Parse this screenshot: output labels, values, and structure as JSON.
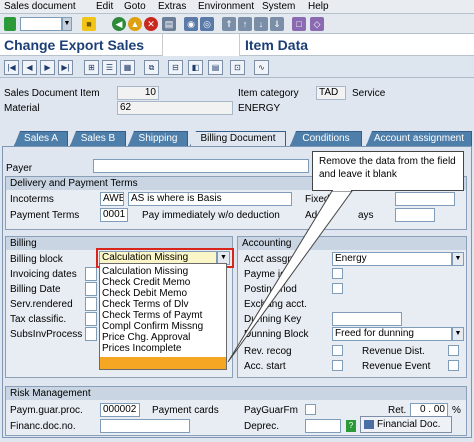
{
  "menu": [
    "Sales document",
    "Edit",
    "Goto",
    "Extras",
    "Environment",
    "System",
    "Help"
  ],
  "title": {
    "left": "Change Export Sales",
    "right": "Item Data"
  },
  "header": {
    "item_label": "Sales Document Item",
    "item_value": "10",
    "material_label": "Material",
    "material_value": "62",
    "category_label": "Item category",
    "category_value": "TAD",
    "category_text": "Service",
    "material_desc": "ENERGY"
  },
  "tabs": [
    "Sales A",
    "Sales B",
    "Shipping",
    "Billing Document",
    "Conditions",
    "Account assignment"
  ],
  "payer_label": "Payer",
  "delivery": {
    "title": "Delivery and Payment Terms",
    "incoterms_label": "Incoterms",
    "incoterms_code": "AWB",
    "incoterms_text": "AS is where is Basis",
    "payterms_label": "Payment Terms",
    "payterms_code": "0001",
    "payterms_text": "Pay immediately w/o deduction",
    "fixed_label": "Fixed",
    "add_label": "Ad",
    "days_label": "ays"
  },
  "billing": {
    "title": "Billing",
    "labels": [
      "Billing block",
      "Invoicing dates",
      "Billing Date",
      "Serv.rendered",
      "Tax classific.",
      "SubsInvProcess"
    ],
    "block_value": "Calculation Missing"
  },
  "dropdown": [
    "Calculation Missing",
    "Check Credit Memo",
    "Check Debit Memo",
    "Check Terms of Dlv",
    "Check Terms of Paymt",
    "Compl Confirm Missng",
    "Price Chg. Approval",
    "Prices Incomplete"
  ],
  "accounting": {
    "title": "Accounting",
    "acct_label": "Acct assgn",
    "acct_value": "Energy",
    "period_label": "Payme   iod",
    "posting_label": "Postin   eriod",
    "exch_label": "Exchang   acct.",
    "dunning_key_label": "Dunning Key",
    "dunning_block_label": "Dunning Block",
    "dunning_block_value": "Freed for dunning",
    "rev_recog_label": "Rev. recog",
    "rev_dist_label": "Revenue Dist.",
    "acc_start_label": "Acc. start",
    "rev_event_label": "Revenue Event"
  },
  "callout": "Remove the data from the field and leave it blank",
  "risk": {
    "title": "Risk Management",
    "paym_label": "Paym.guar.proc.",
    "paym_value": "000002",
    "cards_label": "Payment cards",
    "guar_label": "PayGuarFm",
    "financ_label": "Financ.doc.no.",
    "ret_label": "Ret.",
    "ret_value": "0 . 00",
    "pct": "%",
    "deprec_label": "Deprec.",
    "fin_btn": "Financial Doc."
  },
  "colors": {
    "accent": "#1c3f78",
    "tab": "#4e7eaa",
    "highlight": "#d9261c",
    "selection": "#f5a623"
  }
}
